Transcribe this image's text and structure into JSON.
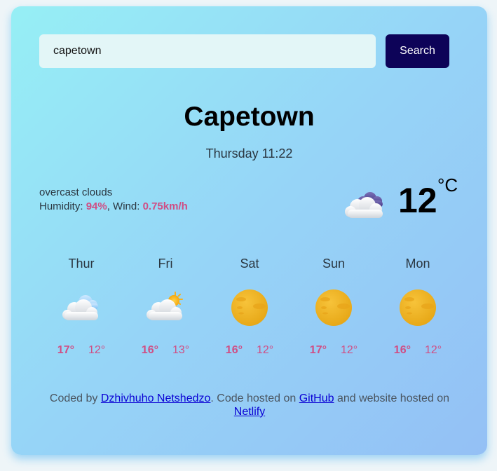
{
  "search": {
    "value": "capetown",
    "button_label": "Search"
  },
  "current": {
    "city": "Capetown",
    "datetime": "Thursday 11:22",
    "description": "overcast clouds",
    "humidity_label": "Humidity: ",
    "humidity_value": "94%",
    "wind_label": ", Wind: ",
    "wind_value": "0.75km/h",
    "temperature": "12",
    "unit": "°C",
    "icon": "overcast-clouds-icon"
  },
  "forecast": [
    {
      "day": "Thur",
      "max": "17°",
      "min": "12°",
      "icon": "cloud-icon"
    },
    {
      "day": "Fri",
      "max": "16°",
      "min": "13°",
      "icon": "partly-sunny-icon"
    },
    {
      "day": "Sat",
      "max": "16°",
      "min": "12°",
      "icon": "moon-icon"
    },
    {
      "day": "Sun",
      "max": "17°",
      "min": "12°",
      "icon": "moon-icon"
    },
    {
      "day": "Mon",
      "max": "16°",
      "min": "12°",
      "icon": "moon-icon"
    }
  ],
  "footer": {
    "text1": "Coded by ",
    "author": "Dzhivhuho Netshedzo",
    "text2": ". Code hosted on ",
    "github": "GitHub",
    "text3": " and website hosted on ",
    "netlify": "Netlify"
  },
  "colors": {
    "accent": "#d04e84",
    "button": "#0d0358"
  }
}
